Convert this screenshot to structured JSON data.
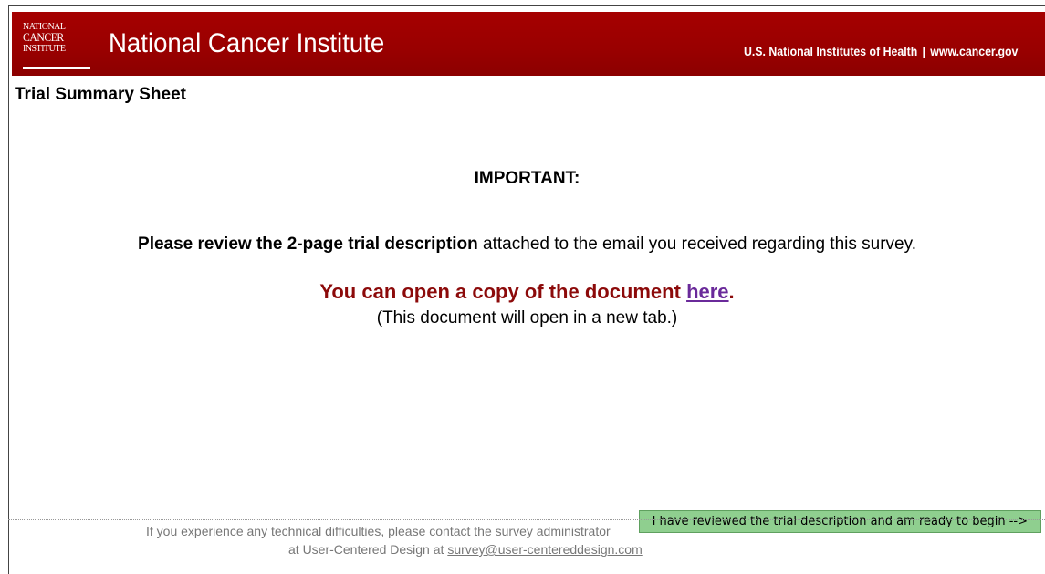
{
  "header": {
    "logo_lines": [
      "National",
      "Cancer",
      "Institute"
    ],
    "org_name": "National Cancer Institute",
    "nih_link": "U.S. National Institutes of Health",
    "separator": "|",
    "site_link": "www.cancer.gov",
    "brand_color": "#990000"
  },
  "page": {
    "title": "Trial Summary Sheet"
  },
  "main": {
    "important": "IMPORTANT:",
    "review_bold": "Please review the 2-page trial description",
    "review_rest": " attached to the email you received regarding this survey.",
    "open_text": "You can open a copy of the document ",
    "open_link": "here",
    "open_period": ".",
    "tab_note": "(This document will open in a new tab.)"
  },
  "actions": {
    "begin_button": "I have reviewed the trial description and am ready to begin -->"
  },
  "footer": {
    "line1": "If you experience any technical difficulties, please contact the survey administrator",
    "line2_prefix": "at User-Centered Design at ",
    "email": "survey@user-centereddesign.com"
  }
}
